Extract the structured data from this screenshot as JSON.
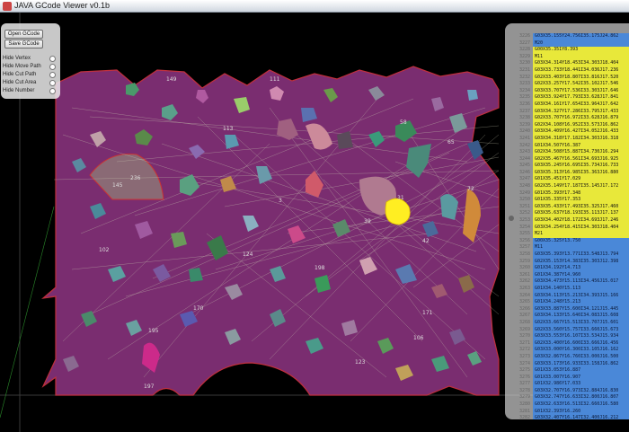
{
  "window": {
    "title": "JAVA GCode Viewer v0.1b"
  },
  "controls": {
    "open_label": "Open GCode",
    "save_label": "Save GCode",
    "toggles": [
      "Hide Vertex",
      "Hide Move Path",
      "Hide Cut Path",
      "Hide Cut Area",
      "Hide Number"
    ]
  },
  "labels": {
    "l1": "149",
    "l2": "111",
    "l3": "145",
    "l4": "113",
    "l5": "58",
    "l6": "65",
    "l7": "72",
    "l8": "236",
    "l9": "31",
    "l10": "42",
    "l11": "39",
    "l12": "3",
    "l13": "195",
    "l14": "170",
    "l15": "198",
    "l16": "171",
    "l17": "197",
    "l18": "106",
    "l19": "102",
    "l20": "124",
    "l21": "123"
  },
  "colors": {
    "sheet": "#7a2d70",
    "sheet_border": "#c0303c",
    "move_path": "#c8c8b0",
    "selected": "#ffee22"
  },
  "code_rows": [
    {
      "ln": "3226",
      "txt": "G03X35.155Y24.756I35.175J24.862",
      "hl": "blue"
    },
    {
      "ln": "3227",
      "txt": "M20",
      "hl": "blue"
    },
    {
      "ln": "3228",
      "txt": "G00X35.351Y8.393",
      "hl": "yellow"
    },
    {
      "ln": "3229",
      "txt": "M11",
      "hl": "yellow"
    },
    {
      "ln": "3230",
      "txt": "G03X34.314Y18.453I34.303J18.404",
      "hl": "yellow"
    },
    {
      "ln": "3231",
      "txt": "G03X33.733Y18.441I34.036J17.236",
      "hl": "yellow"
    },
    {
      "ln": "3232",
      "txt": "G02X33.403Y18.807I33.816J17.520",
      "hl": "yellow"
    },
    {
      "ln": "3233",
      "txt": "G02X33.257Y17.542I35.102J17.546",
      "hl": "yellow"
    },
    {
      "ln": "3234",
      "txt": "G03X33.707Y17.536I33.303J17.646",
      "hl": "yellow"
    },
    {
      "ln": "3235",
      "txt": "G03X33.924Y17.793I33.628J17.841",
      "hl": "yellow"
    },
    {
      "ln": "3236",
      "txt": "G03X34.161Y17.654I33.964J17.642",
      "hl": "yellow"
    },
    {
      "ln": "3237",
      "txt": "G03X34.327Y17.286I33.795J17.433",
      "hl": "yellow"
    },
    {
      "ln": "3238",
      "txt": "G02X33.707Y16.972I33.628J16.879",
      "hl": "yellow"
    },
    {
      "ln": "3239",
      "txt": "G02X34.108Y16.952I33.573J16.862",
      "hl": "yellow"
    },
    {
      "ln": "3240",
      "txt": "G03X34.409Y16.427I34.052J16.433",
      "hl": "yellow"
    },
    {
      "ln": "3241",
      "txt": "G03X34.318Y17.182I34.303J16.318",
      "hl": "yellow"
    },
    {
      "ln": "3242",
      "txt": "G01X34.507Y16.387",
      "hl": "yellow"
    },
    {
      "ln": "3243",
      "txt": "G02X34.508Y15.887I34.730J16.294",
      "hl": "yellow"
    },
    {
      "ln": "3244",
      "txt": "G02X35.467Y16.561I34.693J16.925",
      "hl": "yellow"
    },
    {
      "ln": "3245",
      "txt": "G03X35.245Y16.695I35.734J16.733",
      "hl": "yellow"
    },
    {
      "ln": "3246",
      "txt": "G03X35.313Y16.985I35.363J16.880",
      "hl": "yellow"
    },
    {
      "ln": "3247",
      "txt": "G01X35.451Y17.029",
      "hl": "yellow"
    },
    {
      "ln": "3248",
      "txt": "G02X35.149Y17.187I35.145J17.172",
      "hl": "yellow"
    },
    {
      "ln": "3249",
      "txt": "G01X35.393Y17.348",
      "hl": "yellow"
    },
    {
      "ln": "3250",
      "txt": "G01X35.335Y17.353",
      "hl": "yellow"
    },
    {
      "ln": "3251",
      "txt": "G03X35.433Y17.493I35.325J17.460",
      "hl": "yellow"
    },
    {
      "ln": "3252",
      "txt": "G03X35.637Y18.193I35.113J17.137",
      "hl": "yellow"
    },
    {
      "ln": "3253",
      "txt": "G03X34.402Y18.172I34.693J17.246",
      "hl": "yellow"
    },
    {
      "ln": "3254",
      "txt": "G03X34.254Y18.415I34.303J18.404",
      "hl": "yellow"
    },
    {
      "ln": "3255",
      "txt": "M21",
      "hl": "yellow"
    },
    {
      "ln": "3256",
      "txt": "G00X35.325Y13.750",
      "hl": "blue"
    },
    {
      "ln": "3257",
      "txt": "M11",
      "hl": "blue"
    },
    {
      "ln": "3258",
      "txt": "G03X35.393Y13.771I33.548J13.794",
      "hl": "blue"
    },
    {
      "ln": "3259",
      "txt": "G02X35.153Y14.383I35.303J12.398",
      "hl": "blue"
    },
    {
      "ln": "3260",
      "txt": "G01X34.192Y14.713",
      "hl": "blue"
    },
    {
      "ln": "3261",
      "txt": "G01X34.387Y14.960",
      "hl": "blue"
    },
    {
      "ln": "3262",
      "txt": "G03X34.473Y15.113I34.456J15.017",
      "hl": "blue"
    },
    {
      "ln": "3263",
      "txt": "G01X34.140Y15.113",
      "hl": "blue"
    },
    {
      "ln": "3264",
      "txt": "G03X34.113Y15.213I34.393J15.166",
      "hl": "blue"
    },
    {
      "ln": "3265",
      "txt": "G01X34.248Y15.213",
      "hl": "blue"
    },
    {
      "ln": "3266",
      "txt": "G03X33.887Y15.600I34.121J15.445",
      "hl": "blue"
    },
    {
      "ln": "3267",
      "txt": "G03X34.133Y15.640I34.083J15.608",
      "hl": "blue"
    },
    {
      "ln": "3268",
      "txt": "G02X33.667Y15.513I33.707J15.601",
      "hl": "blue"
    },
    {
      "ln": "3269",
      "txt": "G02X33.560Y15.757I33.660J15.673",
      "hl": "blue"
    },
    {
      "ln": "3270",
      "txt": "G03X33.553Y16.107I33.534J15.934",
      "hl": "blue"
    },
    {
      "ln": "3271",
      "txt": "G02X33.400Y16.600I33.666J16.456",
      "hl": "blue"
    },
    {
      "ln": "3272",
      "txt": "G03X33.000Y16.300I33.105J16.162",
      "hl": "blue"
    },
    {
      "ln": "3273",
      "txt": "G03X32.867Y16.760I33.000J16.500",
      "hl": "blue"
    },
    {
      "ln": "3274",
      "txt": "G03X33.173Y16.933I33.158J16.862",
      "hl": "blue"
    },
    {
      "ln": "3275",
      "txt": "G01X33.053Y16.887",
      "hl": "blue"
    },
    {
      "ln": "3276",
      "txt": "G01X33.007Y16.907",
      "hl": "blue"
    },
    {
      "ln": "3277",
      "txt": "G01X32.986Y17.033",
      "hl": "blue"
    },
    {
      "ln": "3278",
      "txt": "G03X32.707Y16.973I32.884J16.830",
      "hl": "blue"
    },
    {
      "ln": "3279",
      "txt": "G03X32.747Y16.633I32.800J16.807",
      "hl": "blue"
    },
    {
      "ln": "3280",
      "txt": "G03X32.633Y16.513I32.660J16.580",
      "hl": "blue"
    },
    {
      "ln": "3281",
      "txt": "G01X32.393Y16.260",
      "hl": "blue"
    },
    {
      "ln": "3282",
      "txt": "G03X32.407Y16.147I32.400J16.212",
      "hl": "blue"
    },
    {
      "ln": "3283",
      "txt": "G02X32.933Y15.600I32.493J15.933",
      "hl": "blue"
    },
    {
      "ln": "3284",
      "txt": "G03X32.973Y15.520I32.993J15.548",
      "hl": "blue"
    },
    {
      "ln": "3285",
      "txt": "G03X33.093Y15.547I33.033J15.565",
      "hl": "blue"
    }
  ]
}
